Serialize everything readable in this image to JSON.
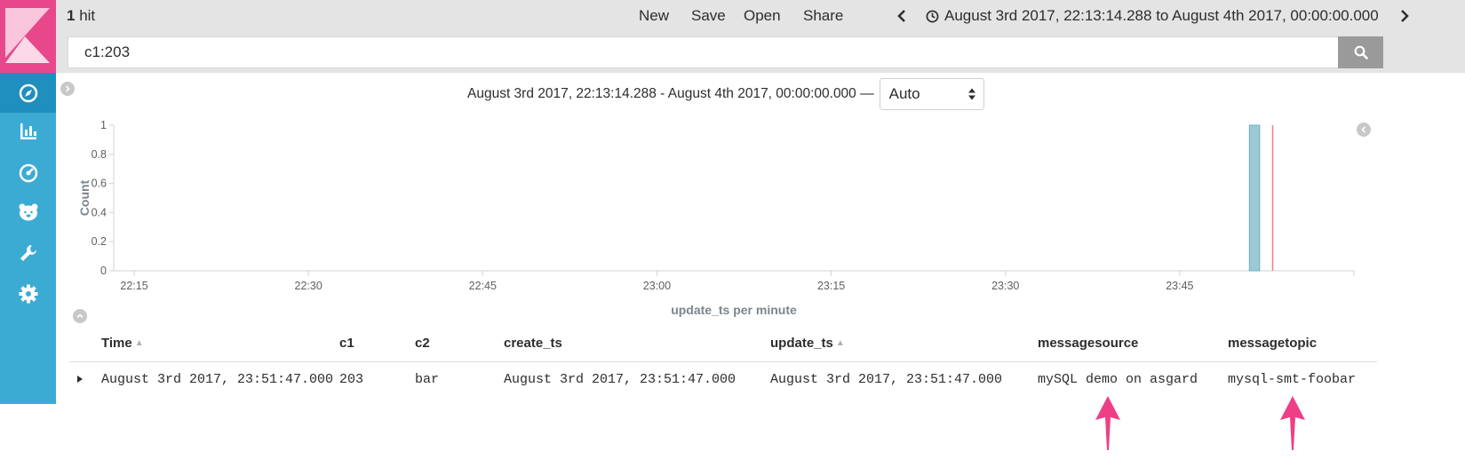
{
  "topbar": {
    "hits_count": "1",
    "hits_label": "hit",
    "menu": {
      "new": "New",
      "save": "Save",
      "open": "Open",
      "share": "Share"
    },
    "time_range": "August 3rd 2017, 22:13:14.288 to August 4th 2017, 00:00:00.000"
  },
  "search": {
    "query": "c1:203"
  },
  "interval": {
    "range_text": "August 3rd 2017, 22:13:14.288 - August 4th 2017, 00:00:00.000 —",
    "selected": "Auto"
  },
  "sidebar": {
    "items": [
      {
        "icon": "compass-icon",
        "active": true
      },
      {
        "icon": "bar-chart-icon"
      },
      {
        "icon": "dashboard-icon"
      },
      {
        "icon": "bear-icon"
      },
      {
        "icon": "wrench-icon"
      },
      {
        "icon": "gear-icon"
      }
    ]
  },
  "chart_data": {
    "type": "bar",
    "xlabel": "update_ts per minute",
    "ylabel": "Count",
    "ylim": [
      0,
      1
    ],
    "yticks": [
      "0",
      "0.2",
      "0.4",
      "0.6",
      "0.8",
      "1"
    ],
    "xticks": [
      "22:15",
      "22:30",
      "22:45",
      "23:00",
      "23:15",
      "23:30",
      "23:45"
    ],
    "xrange": [
      "22:13:14.288",
      "24:00:00.000"
    ],
    "bars": [
      {
        "x": "23:51",
        "value": 1
      }
    ],
    "current_time_marker": "23:53",
    "colors": {
      "bar": "#9cc9d6",
      "marker": "#f08080"
    },
    "grid": false
  },
  "table": {
    "columns": [
      "Time",
      "c1",
      "c2",
      "create_ts",
      "update_ts",
      "messagesource",
      "messagetopic"
    ],
    "rows": [
      [
        "August 3rd 2017, 23:51:47.000",
        "203",
        "bar",
        "August 3rd 2017, 23:51:47.000",
        "August 3rd 2017, 23:51:47.000",
        "mySQL demo on asgard",
        "mysql-smt-foobar"
      ]
    ]
  },
  "colors": {
    "accent": "#3cabd4",
    "brand": "#e8478b",
    "annotation": "#ee3f86"
  }
}
